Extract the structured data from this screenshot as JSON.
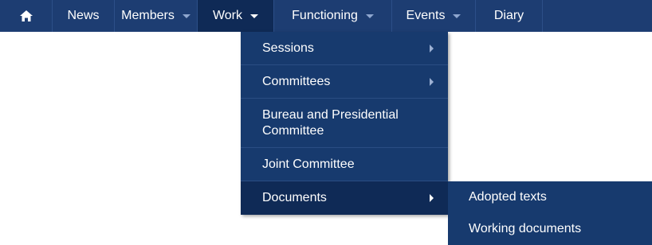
{
  "nav": {
    "home_icon": "home-icon",
    "items": [
      {
        "label": "News"
      },
      {
        "label": "Members"
      },
      {
        "label": "Work"
      },
      {
        "label": "Functioning"
      },
      {
        "label": "Events"
      },
      {
        "label": "Diary"
      }
    ]
  },
  "work_menu": {
    "items": [
      {
        "label": "Sessions"
      },
      {
        "label": "Committees"
      },
      {
        "label": "Bureau and Presidential Committee"
      },
      {
        "label": "Joint Committee"
      },
      {
        "label": "Documents"
      }
    ]
  },
  "documents_submenu": {
    "items": [
      {
        "label": "Adopted texts"
      },
      {
        "label": "Working documents"
      }
    ]
  },
  "colors": {
    "navbar": "#1d3d72",
    "active": "#0f2a56",
    "menu": "#173a6e"
  }
}
